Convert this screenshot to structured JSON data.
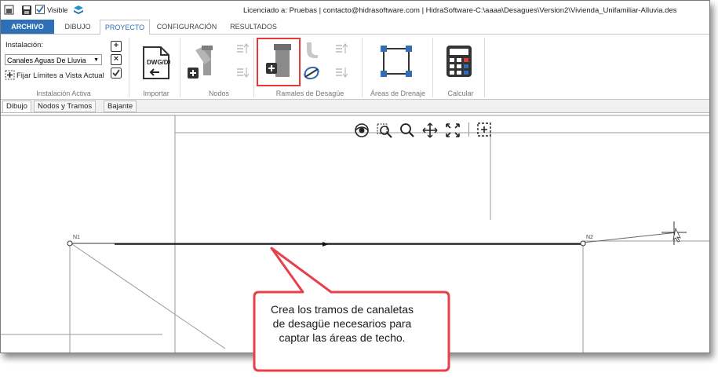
{
  "window": {
    "visible_label": "Visible",
    "title": "Licenciado a: Pruebas | contacto@hidrasoftware.com | HidraSoftware-C:\\aaaa\\Desagues\\Version2\\Vivienda_Unifamiliar-Alluvia.des"
  },
  "ribbon_tabs": [
    "ARCHIVO",
    "DIBUJO",
    "PROYECTO",
    "CONFIGURACIÓN",
    "RESULTADOS"
  ],
  "instalacion": {
    "label": "Instalación:",
    "selected": "Canales Aguas De Lluvia",
    "fijar_label": "Fijar Límites a Vista Actual",
    "group_label": "Instalación Activa"
  },
  "groups": {
    "importar": "Importar",
    "nodos": "Nodos",
    "ramales": "Ramales de Desagüe",
    "areas": "Áreas de Drenaje",
    "calcular": "Calcular"
  },
  "dwg_label": "DWG/DXF",
  "doc_tabs": [
    "Dibujo",
    "Nodos y Tramos",
    "Bajante"
  ],
  "nodes": [
    "N1",
    "N2"
  ],
  "callout": "Crea los tramos de canaletas de desagüe necesarios para captar las áreas de techo.",
  "colors": {
    "accent": "#2f6fb5",
    "highlight": "#e53935",
    "callout_border": "#e8404a"
  },
  "icons": [
    "save-icon",
    "visible-checkbox",
    "layers-icon",
    "add-icon",
    "delete-icon",
    "check-icon",
    "dwg-import-icon",
    "pipe-y-icon",
    "pipe-straight-icon",
    "pipe-elbow-icon",
    "rotate-icon",
    "area-icon",
    "calculator-icon",
    "eye-icon",
    "zoom-window-icon",
    "zoom-icon",
    "pan-icon",
    "extents-icon",
    "select-icon"
  ]
}
